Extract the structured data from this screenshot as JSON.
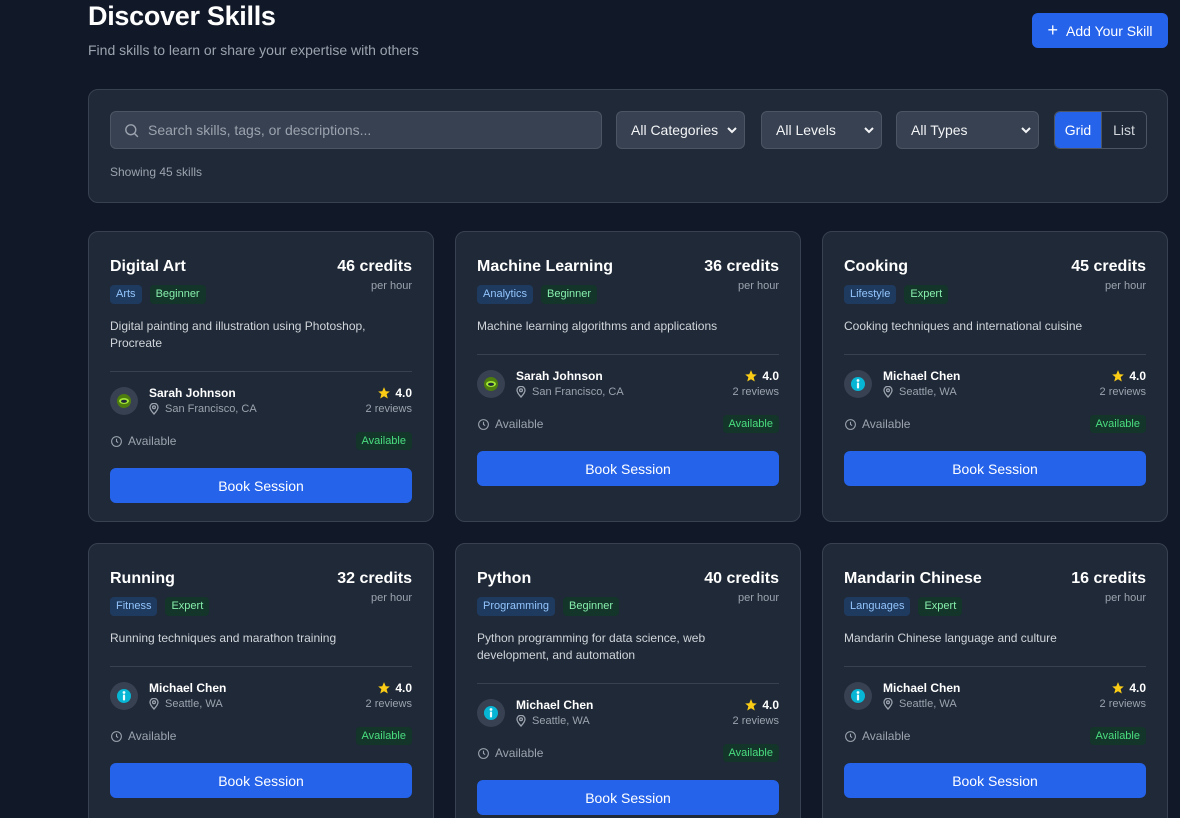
{
  "header": {
    "title": "Discover Skills",
    "subtitle": "Find skills to learn or share your expertise with others",
    "add_button_label": "Add Your Skill"
  },
  "filters": {
    "search_placeholder": "Search skills, tags, or descriptions...",
    "category": "All Categories",
    "level": "All Levels",
    "type": "All Types",
    "view_grid": "Grid",
    "view_list": "List",
    "active_view": "Grid",
    "showing": "Showing 45 skills"
  },
  "cards": [
    {
      "title": "Digital Art",
      "credits": "46 credits",
      "per": "per hour",
      "category": "Arts",
      "level": "Beginner",
      "description": "Digital painting and illustration using Photoshop, Procreate",
      "owner": "Sarah Johnson",
      "location": "San Francisco, CA",
      "avatar": "alien-avatar-icon",
      "rating": "4.0",
      "reviews": "2 reviews",
      "availability": "Available",
      "badge": "Available",
      "cta": "Book Session"
    },
    {
      "title": "Machine Learning",
      "credits": "36 credits",
      "per": "per hour",
      "category": "Analytics",
      "level": "Beginner",
      "description": "Machine learning algorithms and applications",
      "owner": "Sarah Johnson",
      "location": "San Francisco, CA",
      "avatar": "alien-avatar-icon",
      "rating": "4.0",
      "reviews": "2 reviews",
      "availability": "Available",
      "badge": "Available",
      "cta": "Book Session"
    },
    {
      "title": "Cooking",
      "credits": "45 credits",
      "per": "per hour",
      "category": "Lifestyle",
      "level": "Expert",
      "description": "Cooking techniques and international cuisine",
      "owner": "Michael Chen",
      "location": "Seattle, WA",
      "avatar": "figure-avatar-icon",
      "rating": "4.0",
      "reviews": "2 reviews",
      "availability": "Available",
      "badge": "Available",
      "cta": "Book Session"
    },
    {
      "title": "Running",
      "credits": "32 credits",
      "per": "per hour",
      "category": "Fitness",
      "level": "Expert",
      "description": "Running techniques and marathon training",
      "owner": "Michael Chen",
      "location": "Seattle, WA",
      "avatar": "figure-avatar-icon",
      "rating": "4.0",
      "reviews": "2 reviews",
      "availability": "Available",
      "badge": "Available",
      "cta": "Book Session"
    },
    {
      "title": "Python",
      "credits": "40 credits",
      "per": "per hour",
      "category": "Programming",
      "level": "Beginner",
      "description": "Python programming for data science, web development, and automation",
      "owner": "Michael Chen",
      "location": "Seattle, WA",
      "avatar": "figure-avatar-icon",
      "rating": "4.0",
      "reviews": "2 reviews",
      "availability": "Available",
      "badge": "Available",
      "cta": "Book Session"
    },
    {
      "title": "Mandarin Chinese",
      "credits": "16 credits",
      "per": "per hour",
      "category": "Languages",
      "level": "Expert",
      "description": "Mandarin Chinese language and culture",
      "owner": "Michael Chen",
      "location": "Seattle, WA",
      "avatar": "figure-avatar-icon",
      "rating": "4.0",
      "reviews": "2 reviews",
      "availability": "Available",
      "badge": "Available",
      "cta": "Book Session"
    }
  ],
  "colors": {
    "background": "#111827",
    "panel": "#1f2937",
    "accent": "#2563eb",
    "available": "#4ade80",
    "star": "#facc15"
  }
}
